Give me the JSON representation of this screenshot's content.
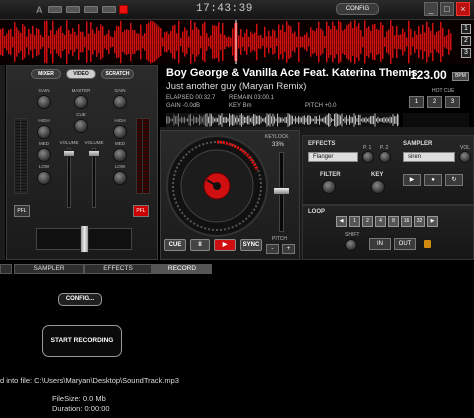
{
  "topbar": {
    "letters": [
      "A",
      "B"
    ],
    "clock": "17:43:39",
    "config_label": "CONFIG",
    "window_buttons": [
      "_",
      "□",
      "×"
    ]
  },
  "waveform": {
    "zoom_buttons": [
      "1",
      "2",
      "3"
    ],
    "color": "#d01010"
  },
  "mixer": {
    "tabs": [
      "MIXER",
      "VIDEO",
      "SCRATCH"
    ],
    "gain_label": "GAIN",
    "master_label": "MASTER",
    "high_label": "HIGH",
    "cue_label": "CUE",
    "med_label": "MED",
    "low_label": "LOW",
    "volume_label": "VOLUME",
    "pfl_label": "PFL"
  },
  "deck": {
    "artist_title": "Boy George & Vanilla Ace Feat. Katerina Themis",
    "track_subtitle": "Just another guy (Maryan Remix)",
    "bpm": "123.00",
    "bpm_unit": "BPM",
    "elapsed": "ELAPSED 00:32.7",
    "remain": "REMAIN 03:00.1",
    "gain": "GAIN -0.0dB",
    "key": "KEY Bm",
    "pitch": "PITCH +0.0",
    "hot_cue_label": "HOT CUE",
    "hot_cues": [
      "1",
      "2",
      "3"
    ],
    "keylock_label": "KEYLOCK",
    "keylock_value": "33%",
    "pitch_label": "PITCH",
    "transport": [
      "CUE",
      "II",
      "▶",
      "SYNC"
    ]
  },
  "effects": {
    "label": "EFFECTS",
    "selected": "Flanger",
    "p1": "P. 1",
    "p2": "P. 2",
    "filter_label": "FILTER",
    "key_label": "KEY",
    "sampler_label": "SAMPLER",
    "sampler_selected": "siren",
    "vol_label": "VOL"
  },
  "loop": {
    "label": "LOOP",
    "sizes": [
      "1",
      "2",
      "4",
      "8",
      "16",
      "32"
    ],
    "shift_label": "SHIFT",
    "in_label": "IN",
    "out_label": "OUT"
  },
  "bottom_tabs": [
    "SAMPLER",
    "EFFECTS",
    "RECORD"
  ],
  "record": {
    "config_label": "CONFIG...",
    "start_label": "START RECORDING",
    "file_line": "d into file: C:\\Users\\Maryan\\Desktop\\SoundTrack.mp3",
    "filesize_line": "FileSize: 0.0 Mb",
    "duration_line": "Duration: 0:00:00"
  },
  "colors": {
    "accent_red": "#e01010",
    "panel_dark": "#1a1a1a"
  }
}
